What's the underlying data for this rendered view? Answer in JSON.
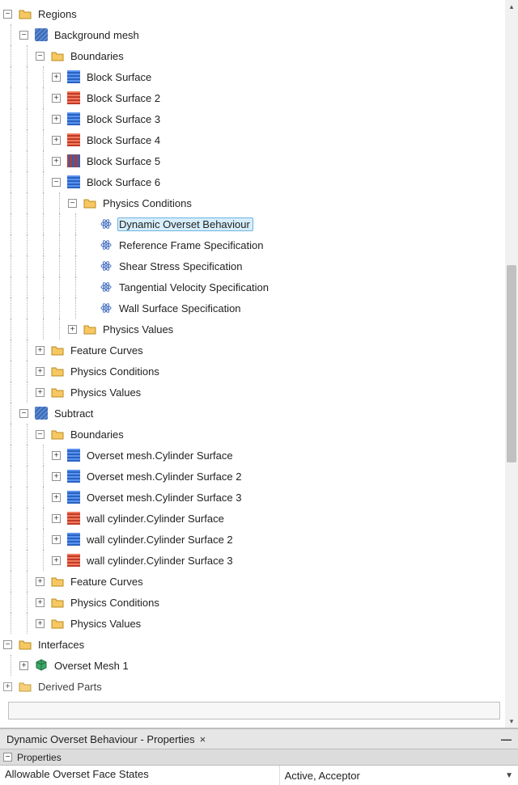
{
  "tree": {
    "regions": "Regions",
    "background_mesh": "Background mesh",
    "boundaries": "Boundaries",
    "block_surfaces": [
      "Block Surface",
      "Block Surface 2",
      "Block Surface 3",
      "Block Surface 4",
      "Block Surface 5",
      "Block Surface 6"
    ],
    "physics_conditions": "Physics Conditions",
    "physics_conditions_items": [
      "Dynamic Overset Behaviour",
      "Reference Frame Specification",
      "Shear Stress Specification",
      "Tangential Velocity Specification",
      "Wall Surface Specification"
    ],
    "physics_values": "Physics Values",
    "feature_curves": "Feature Curves",
    "subtract": "Subtract",
    "subtract_boundaries": [
      "Overset mesh.Cylinder Surface",
      "Overset mesh.Cylinder Surface 2",
      "Overset mesh.Cylinder Surface 3",
      "wall cylinder.Cylinder Surface",
      "wall cylinder.Cylinder Surface 2",
      "wall cylinder.Cylinder Surface 3"
    ],
    "interfaces": "Interfaces",
    "overset_mesh_1": "Overset Mesh 1",
    "derived_parts": "Derived Parts"
  },
  "properties_panel": {
    "title": "Dynamic Overset Behaviour - Properties",
    "section": "Properties",
    "rows": [
      {
        "name": "Allowable Overset Face States",
        "value": "Active, Acceptor"
      }
    ]
  },
  "block_surface_icon_variants": [
    "blue",
    "red",
    "blue",
    "red",
    "bars",
    "blue"
  ],
  "subtract_boundary_icon_variants": [
    "blue",
    "blue",
    "blue",
    "red",
    "blue",
    "red"
  ]
}
